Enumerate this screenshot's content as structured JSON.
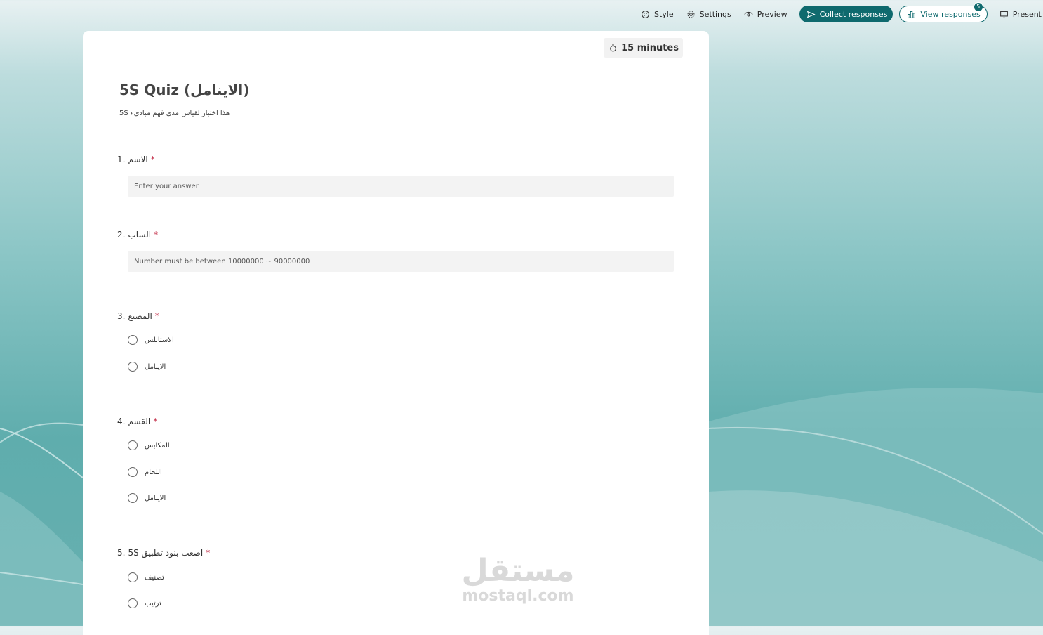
{
  "toolbar": {
    "style": "Style",
    "settings": "Settings",
    "preview": "Preview",
    "collect": "Collect responses",
    "view": "View responses",
    "view_badge": "5",
    "present": "Present"
  },
  "form": {
    "timer": "15 minutes",
    "title": "5S Quiz (الاينامل)",
    "description": "هذا اختبار لقياس مدى فهم مبادىء  5S",
    "questions": [
      {
        "number": "1.",
        "text": "الاسم",
        "required": "*",
        "placeholder": "Enter your answer"
      },
      {
        "number": "2.",
        "text": "الساب",
        "required": "*",
        "placeholder": "Number must be between 10000000 ~ 90000000"
      },
      {
        "number": "3.",
        "text": "المصنع",
        "required": "*",
        "options": [
          "الاستانلس",
          "الاينامل"
        ]
      },
      {
        "number": "4.",
        "text": "القسم",
        "required": "*",
        "options": [
          "المكابس",
          "اللحام",
          "الاينامل"
        ]
      },
      {
        "number": "5.",
        "text": "اصعب بنود تطبيق 5S",
        "required": "*",
        "options": [
          "تصنيف",
          "ترتيب"
        ]
      }
    ]
  },
  "watermark": {
    "arabic": "مستقل",
    "latin": "mostaql.com"
  },
  "colors": {
    "accent": "#0f6a6e",
    "required": "#c4314b"
  }
}
